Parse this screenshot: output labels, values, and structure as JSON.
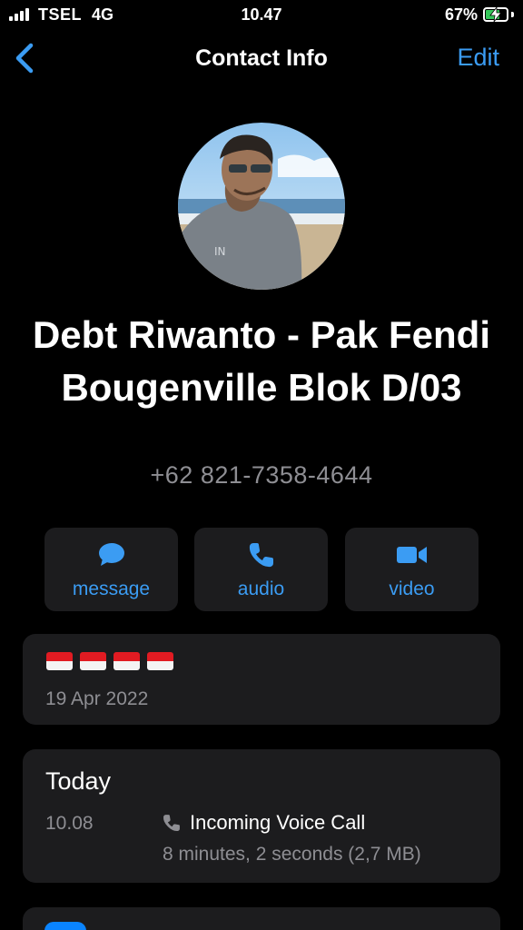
{
  "status_bar": {
    "carrier": "TSEL",
    "network": "4G",
    "time": "10.47",
    "battery_percent": "67%",
    "battery_level": 0.67,
    "battery_color": "#34c759"
  },
  "nav": {
    "back_icon": "chevron-left-icon",
    "title": "Contact Info",
    "edit_label": "Edit",
    "accent_color": "#3b9cf3"
  },
  "contact": {
    "avatar": "profile-photo",
    "name": "Debt Riwanto - Pak Fendi Bougenville Blok D/03",
    "phone": "+62 821-7358-4644"
  },
  "actions": [
    {
      "icon": "message-bubble-icon",
      "label": "message"
    },
    {
      "icon": "phone-icon",
      "label": "audio"
    },
    {
      "icon": "video-camera-icon",
      "label": "video"
    }
  ],
  "about": {
    "flags": [
      "indonesia-flag-icon",
      "indonesia-flag-icon",
      "indonesia-flag-icon",
      "indonesia-flag-icon"
    ],
    "date": "19 Apr 2022"
  },
  "calls": {
    "heading": "Today",
    "items": [
      {
        "time": "10.08",
        "icon": "phone-icon",
        "type": "Incoming Voice Call",
        "detail": "8 minutes, 2 seconds (2,7 MB)"
      }
    ]
  }
}
